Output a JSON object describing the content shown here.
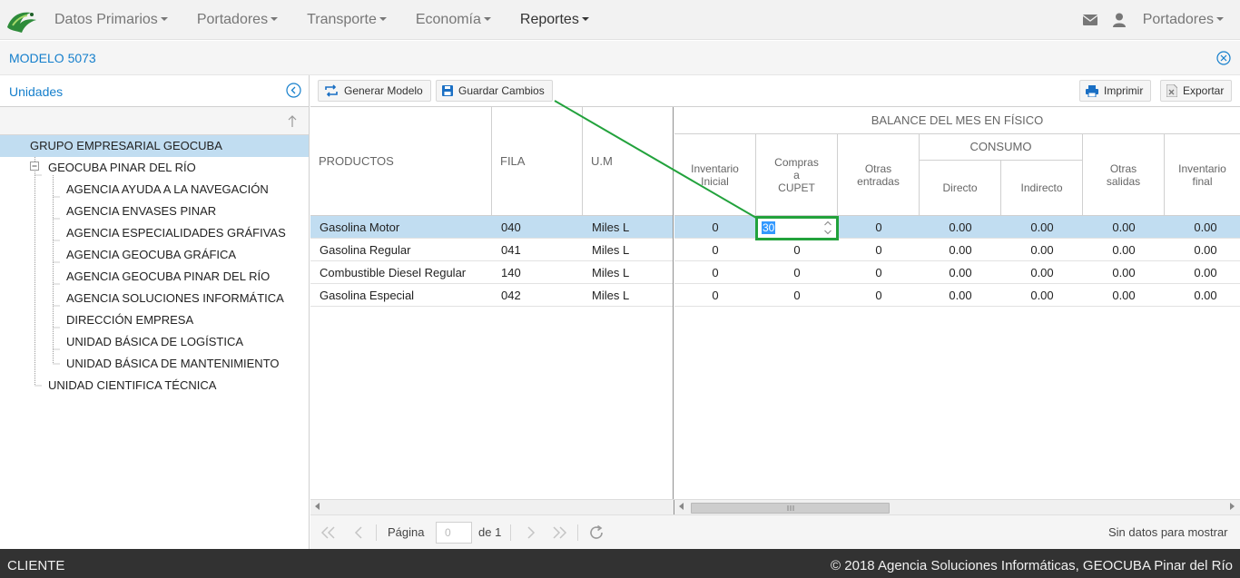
{
  "nav": {
    "menu": [
      {
        "label": "Datos Primarios"
      },
      {
        "label": "Portadores"
      },
      {
        "label": "Transporte"
      },
      {
        "label": "Economía"
      },
      {
        "label": "Reportes"
      }
    ],
    "user_menu_label": "Portadores"
  },
  "panel": {
    "title": "MODELO 5073"
  },
  "units": {
    "title": "Unidades",
    "tree": [
      {
        "label": "GRUPO EMPRESARIAL GEOCUBA",
        "level": 0,
        "selected": true
      },
      {
        "label": "GEOCUBA PINAR DEL RÍO",
        "level": 1
      },
      {
        "label": "AGENCIA AYUDA A LA NAVEGACIÓN",
        "level": 2
      },
      {
        "label": "AGENCIA ENVASES PINAR",
        "level": 2
      },
      {
        "label": "AGENCIA ESPECIALIDADES GRÁFIVAS",
        "level": 2
      },
      {
        "label": "AGENCIA GEOCUBA GRÁFICA",
        "level": 2
      },
      {
        "label": "AGENCIA GEOCUBA PINAR DEL RÍO",
        "level": 2
      },
      {
        "label": "AGENCIA SOLUCIONES INFORMÁTICA",
        "level": 2
      },
      {
        "label": "DIRECCIÓN EMPRESA",
        "level": 2
      },
      {
        "label": "UNIDAD BÁSICA DE LOGÍSTICA",
        "level": 2
      },
      {
        "label": "UNIDAD BÁSICA DE MANTENIMIENTO",
        "level": 2
      },
      {
        "label": "UNIDAD CIENTIFICA TÉCNICA",
        "level": 1
      }
    ]
  },
  "toolbar": {
    "generar": "Generar Modelo",
    "guardar": "Guardar Cambios",
    "imprimir": "Imprimir",
    "exportar": "Exportar"
  },
  "grid": {
    "headers": {
      "productos": "PRODUCTOS",
      "fila": "FILA",
      "um": "U.M",
      "balance": "BALANCE DEL MES EN FÍSICO",
      "inventario_inicial": "Inventario Inicial",
      "compras_cupet": "Compras a CUPET",
      "otras_entradas": "Otras entradas",
      "consumo": "CONSUMO",
      "directo": "Directo",
      "indirecto": "Indirecto",
      "otras_salidas": "Otras salidas",
      "inventario_final": "Inventario final"
    },
    "rows": [
      {
        "producto": "Gasolina Motor",
        "fila": "040",
        "um": "Miles L",
        "inv_inicial": "0",
        "compras": "30",
        "otras_entradas": "0",
        "directo": "0.00",
        "indirecto": "0.00",
        "otras_salidas": "0.00",
        "inv_final": "0.00",
        "selected": true
      },
      {
        "producto": "Gasolina Regular",
        "fila": "041",
        "um": "Miles L",
        "inv_inicial": "0",
        "compras": "0",
        "otras_entradas": "0",
        "directo": "0.00",
        "indirecto": "0.00",
        "otras_salidas": "0.00",
        "inv_final": "0.00"
      },
      {
        "producto": "Combustible Diesel Regular",
        "fila": "140",
        "um": "Miles L",
        "inv_inicial": "0",
        "compras": "0",
        "otras_entradas": "0",
        "directo": "0.00",
        "indirecto": "0.00",
        "otras_salidas": "0.00",
        "inv_final": "0.00"
      },
      {
        "producto": "Gasolina Especial",
        "fila": "042",
        "um": "Miles L",
        "inv_inicial": "0",
        "compras": "0",
        "otras_entradas": "0",
        "directo": "0.00",
        "indirecto": "0.00",
        "otras_salidas": "0.00",
        "inv_final": "0.00"
      }
    ]
  },
  "pager": {
    "page_label": "Página",
    "page_value": "0",
    "of_label": "de 1",
    "status": "Sin datos para mostrar"
  },
  "footer": {
    "left": "CLIENTE",
    "right": "© 2018 Agencia Soluciones Informáticas, GEOCUBA Pinar del Río"
  },
  "colors": {
    "accent": "#157fcc",
    "selection": "#c1ddf1",
    "editor_border": "#22a23c",
    "footer_bg": "#323232"
  }
}
